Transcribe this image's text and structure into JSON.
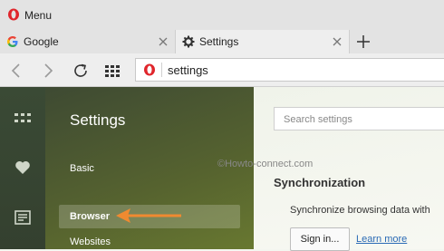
{
  "window": {
    "menu_label": "Menu"
  },
  "tabs": [
    {
      "title": "Google",
      "favicon": "google-g-icon",
      "active": false
    },
    {
      "title": "Settings",
      "favicon": "gear-icon",
      "active": true
    }
  ],
  "toolbar": {
    "buttons": [
      "back-arrow-icon",
      "forward-arrow-icon",
      "reload-icon",
      "speed-dial-grid-icon"
    ],
    "url": "settings"
  },
  "sidebar_icons": [
    "speed-dial-icon",
    "heart-icon",
    "news-icon"
  ],
  "settings_nav": {
    "heading": "Settings",
    "items": [
      {
        "label": "Basic",
        "active": false
      },
      {
        "label": "Browser",
        "active": true
      },
      {
        "label": "Websites",
        "active": false
      }
    ]
  },
  "main": {
    "search_placeholder": "Search settings",
    "watermark": "©Howto-connect.com",
    "sync_title": "Synchronization",
    "sync_desc": "Synchronize browsing data with",
    "signin_label": "Sign in...",
    "learn_more_label": "Learn more"
  },
  "colors": {
    "opera_red": "#e0262c",
    "annotation_arrow": "#f08a30",
    "sidebar_dark": "#3a4a35",
    "link_blue": "#2a6ab5"
  }
}
